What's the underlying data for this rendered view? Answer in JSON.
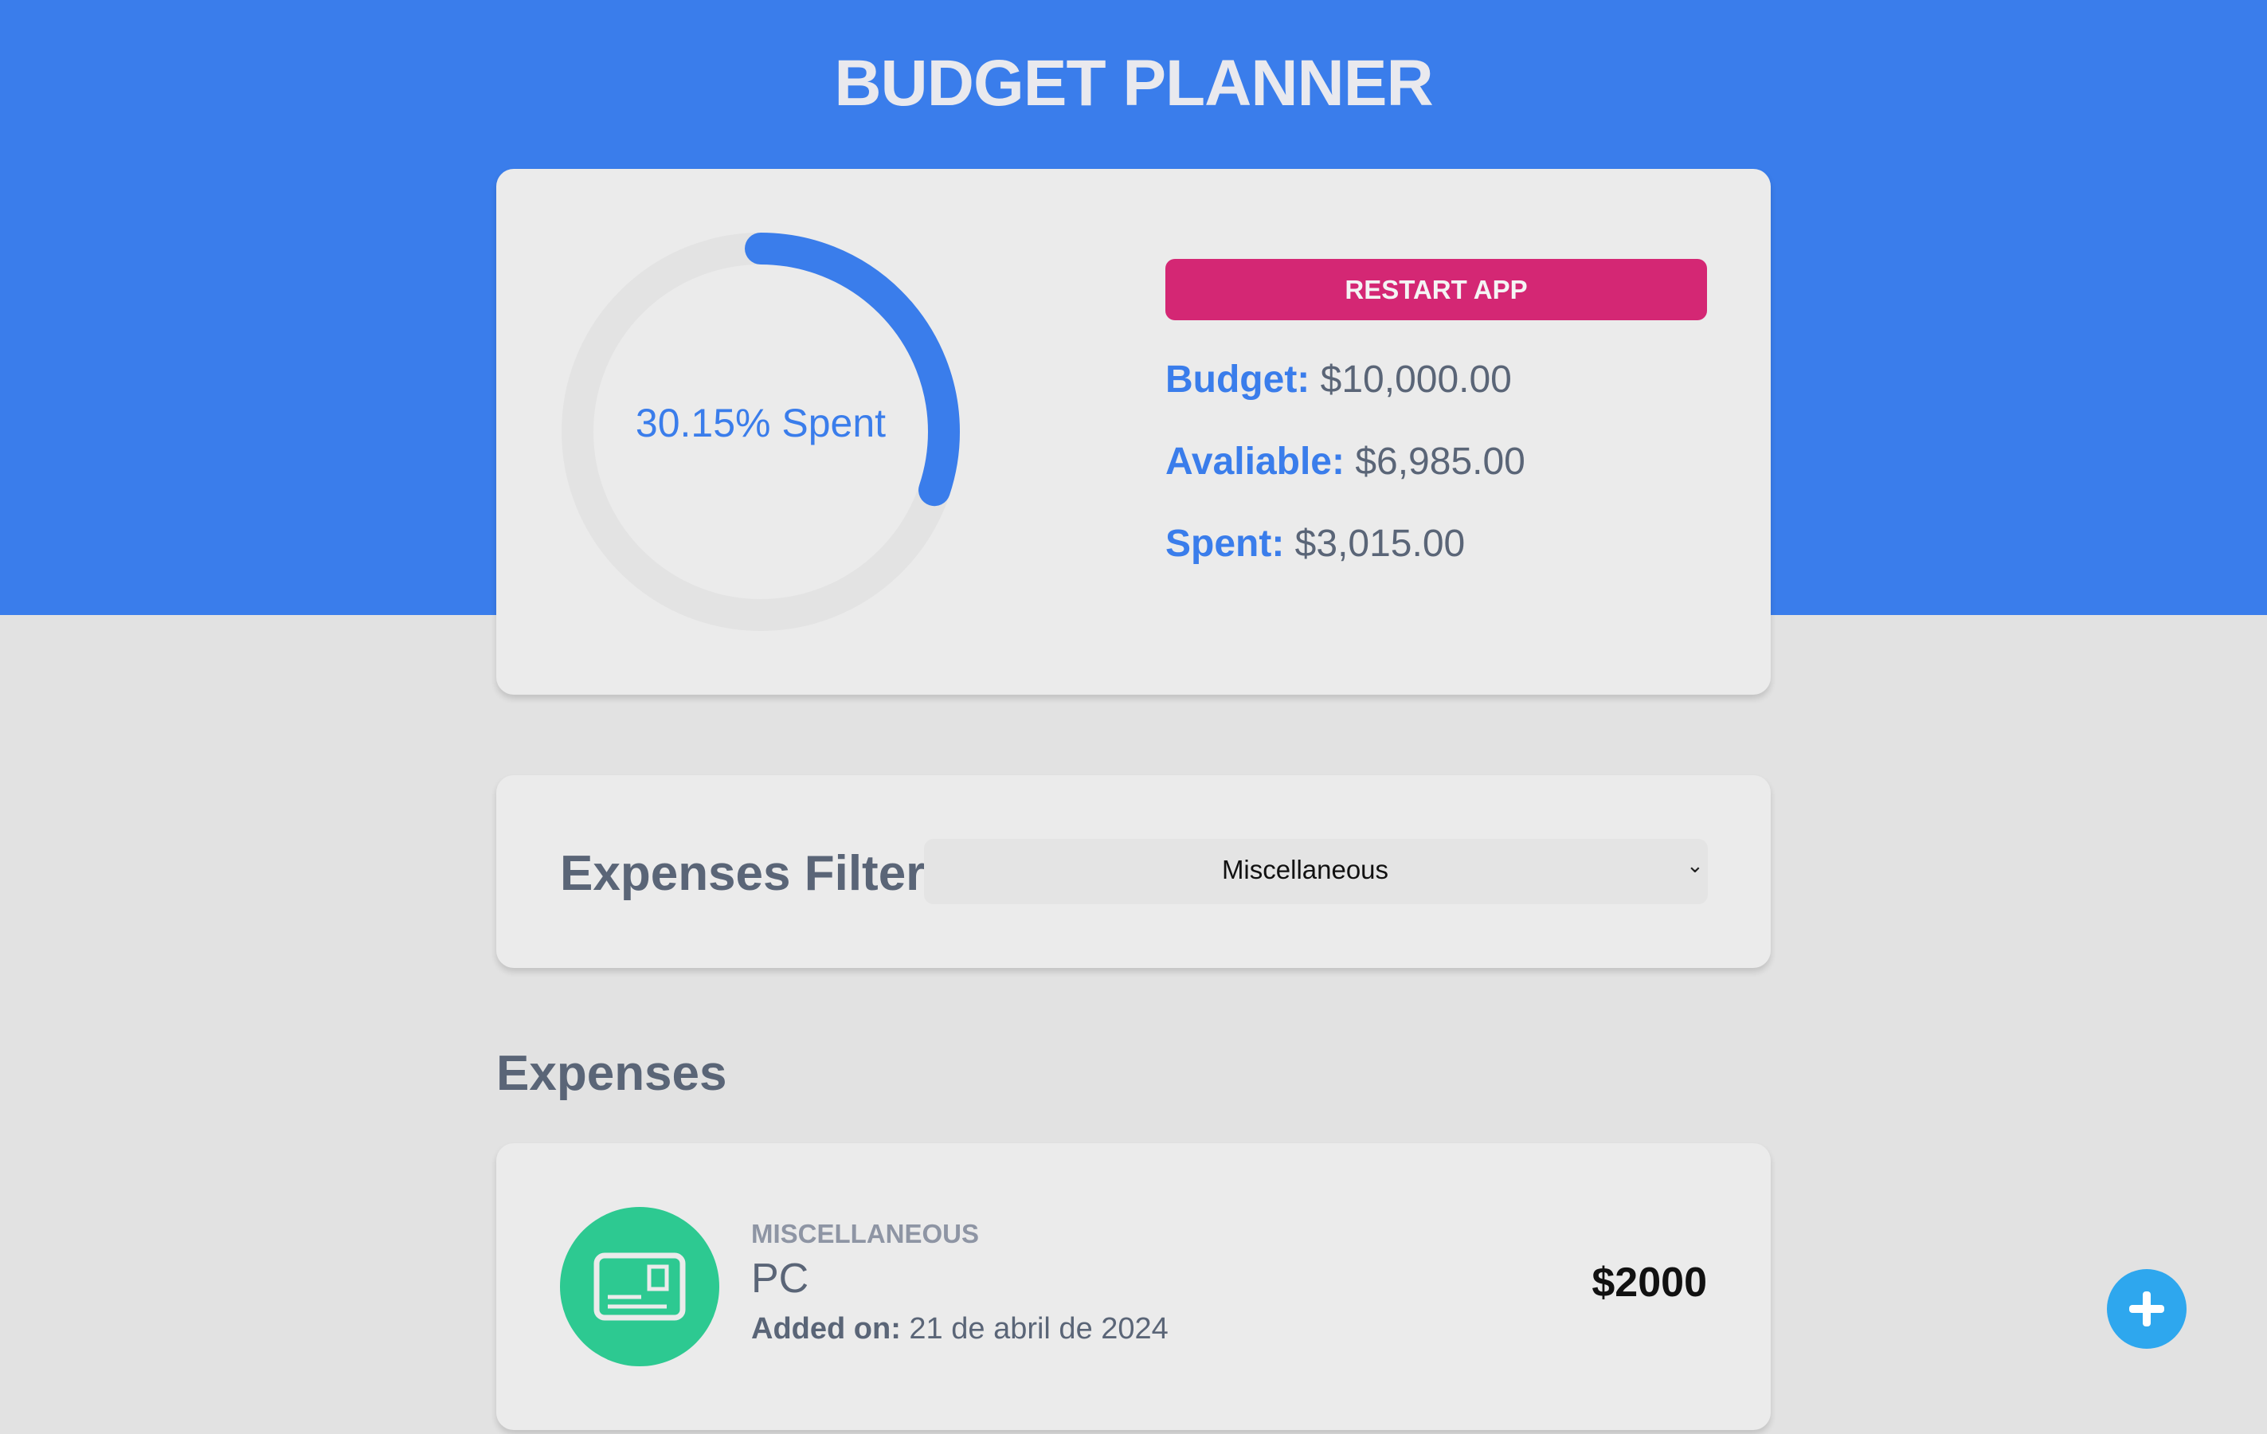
{
  "header": {
    "title": "BUDGET PLANNER"
  },
  "summary": {
    "percent_spent": 30.15,
    "progress_label": "30.15% Spent",
    "restart_label": "RESTART APP",
    "budget_label": "Budget:",
    "budget_value": "$10,000.00",
    "available_label": "Avaliable:",
    "available_value": "$6,985.00",
    "spent_label": "Spent:",
    "spent_value": "$3,015.00"
  },
  "filter": {
    "label": "Expenses Filter",
    "selected": "Miscellaneous"
  },
  "expenses": {
    "title": "Expenses",
    "items": [
      {
        "category": "MISCELLANEOUS",
        "name": "PC",
        "date_label": "Added on:",
        "date": "21 de abril de 2024",
        "amount": "$2000",
        "icon": "card-icon"
      }
    ]
  },
  "fab": {
    "icon": "plus-icon"
  },
  "colors": {
    "primary": "#3a7deb",
    "restart": "#d42774",
    "category_icon_bg": "#2dc991",
    "fab": "#2ea7ee"
  }
}
